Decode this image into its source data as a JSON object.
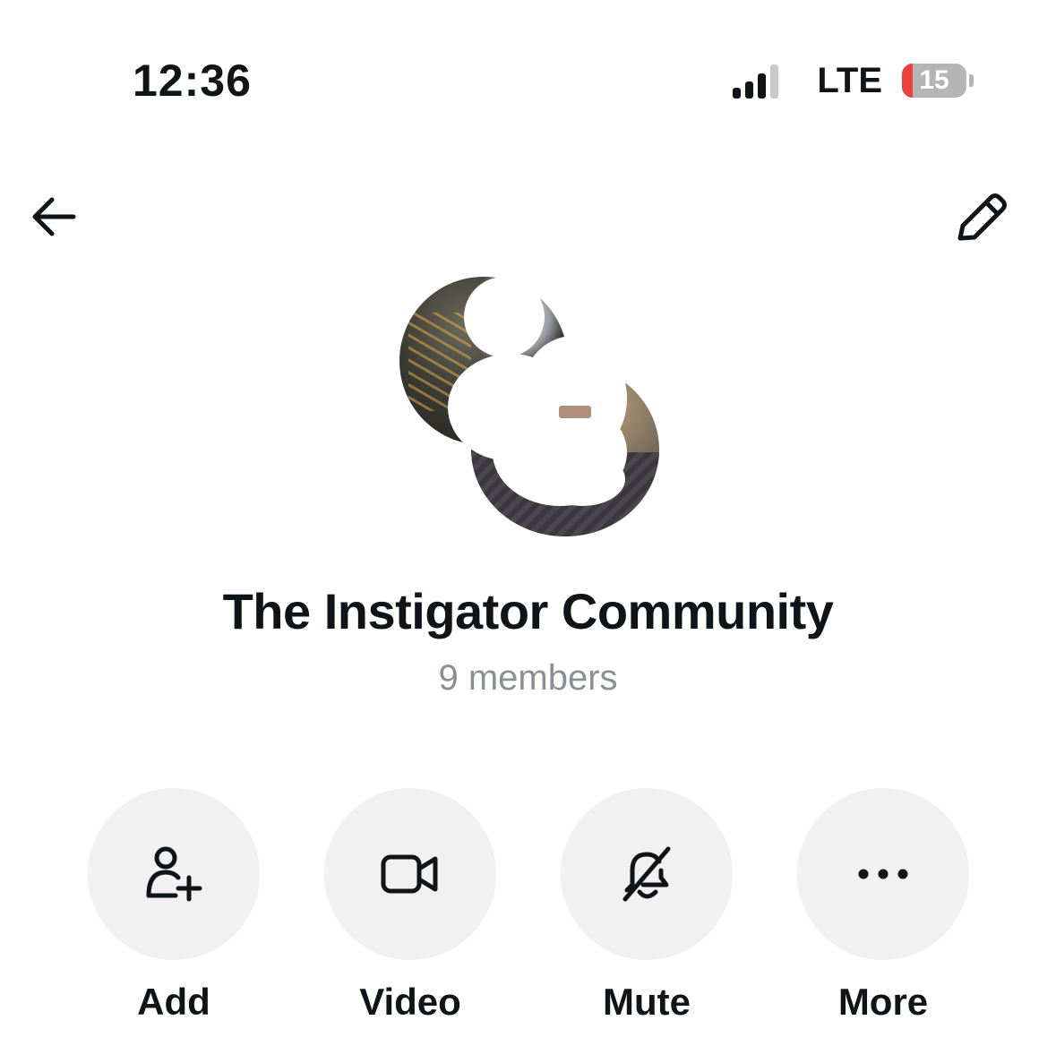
{
  "status_bar": {
    "time": "12:36",
    "network": "LTE",
    "battery_level": "15",
    "battery_color": "#e94040"
  },
  "nav": {
    "back_icon": "arrow-left-icon",
    "edit_icon": "pencil-icon"
  },
  "group": {
    "title": "The Instigator Community",
    "members": "9 members"
  },
  "actions": [
    {
      "label": "Add",
      "icon": "add-person-icon"
    },
    {
      "label": "Video",
      "icon": "video-camera-icon"
    },
    {
      "label": "Mute",
      "icon": "bell-off-icon"
    },
    {
      "label": "More",
      "icon": "more-dots-icon"
    }
  ],
  "colors": {
    "text": "#0f1419",
    "secondary_text": "#8b8f93",
    "action_bg": "#f1f1f1"
  }
}
